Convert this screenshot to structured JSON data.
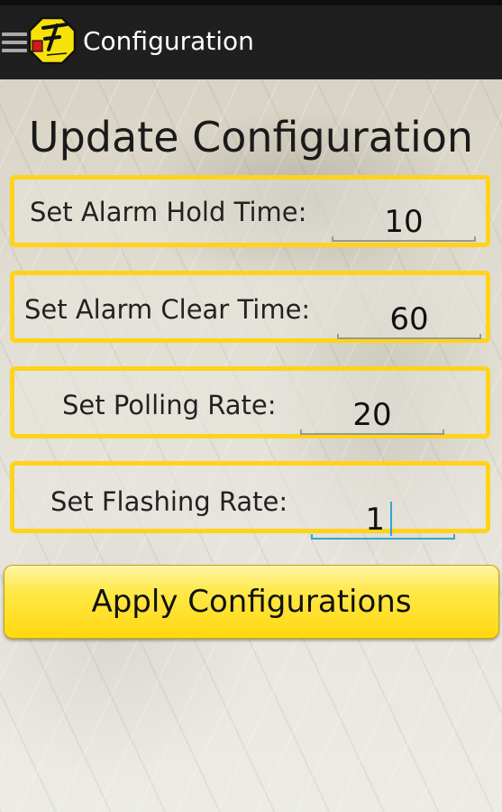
{
  "app": {
    "title": "Configuration"
  },
  "page": {
    "heading": "Update Configuration"
  },
  "settings": [
    {
      "label": "Set Alarm Hold Time:",
      "value": "10"
    },
    {
      "label": "Set Alarm Clear Time:",
      "value": "60"
    },
    {
      "label": "Set Polling Rate:",
      "value": "20"
    },
    {
      "label": "Set Flashing Rate:",
      "value": "1"
    }
  ],
  "actions": {
    "apply_label": "Apply Configurations"
  },
  "colors": {
    "accent": "#ffd319",
    "focus": "#33a6cf",
    "actionbar": "#1f1f1f"
  },
  "icons": {
    "menu": "hamburger-icon",
    "logo": "app-logo-icon"
  }
}
